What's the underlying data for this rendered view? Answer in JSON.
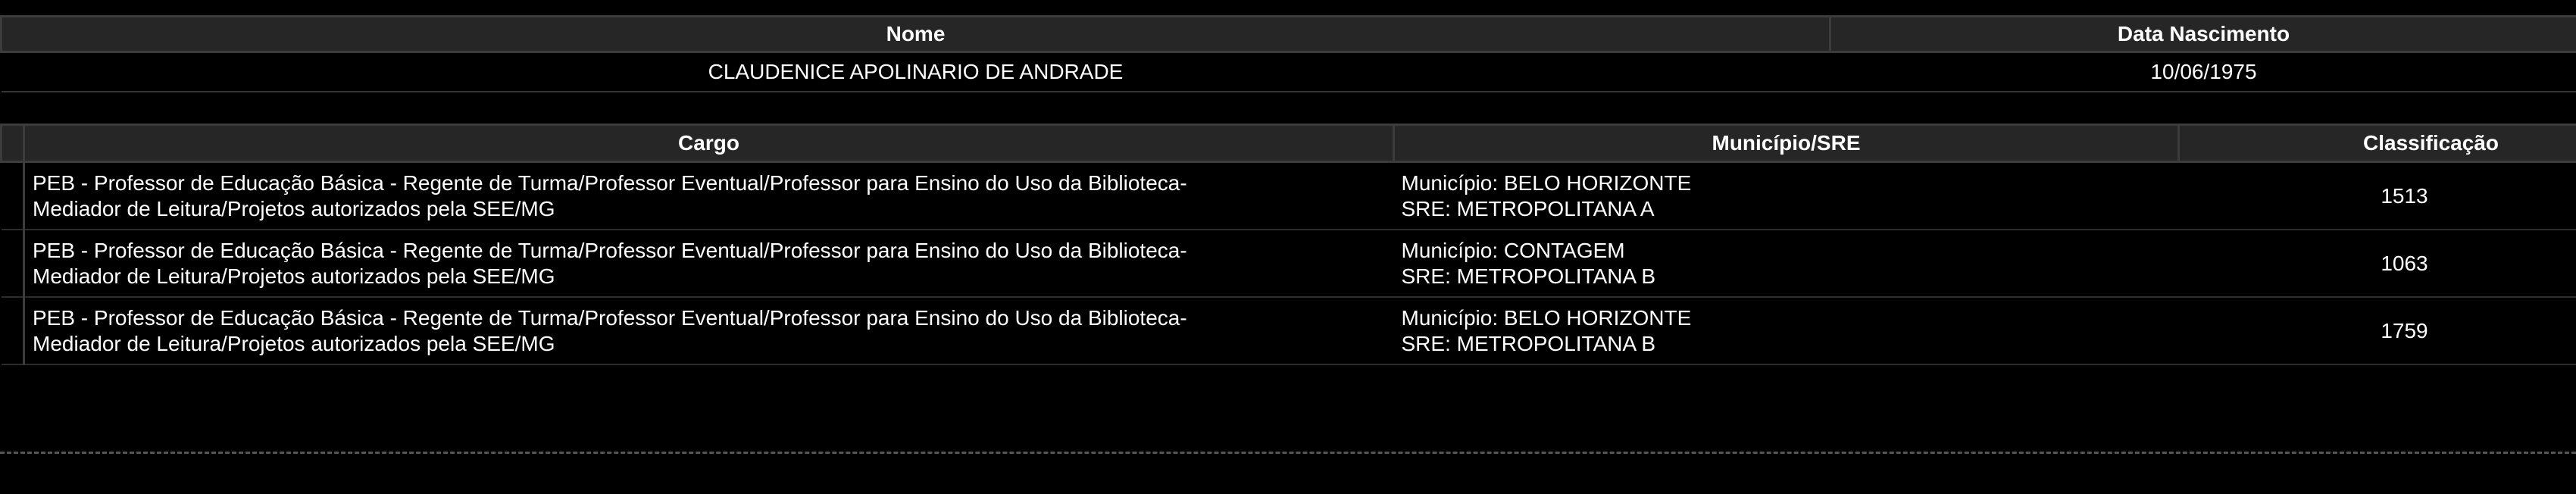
{
  "person": {
    "headers": {
      "nome": "Nome",
      "data_nascimento": "Data Nascimento"
    },
    "row": {
      "nome": "CLAUDENICE APOLINARIO DE ANDRADE",
      "data_nascimento": "10/06/1975"
    }
  },
  "cargos": {
    "headers": {
      "cargo": "Cargo",
      "municipio_sre": "Município/SRE",
      "classificacao": "Classificação"
    },
    "rows": [
      {
        "cargo_line1": "PEB - Professor de Educação Básica - Regente de Turma/Professor Eventual/Professor para Ensino do Uso da Biblioteca-",
        "cargo_line2": "Mediador de Leitura/Projetos autorizados pela SEE/MG",
        "municipio": "Município: BELO HORIZONTE",
        "sre": "SRE: METROPOLITANA A",
        "classificacao": "1513"
      },
      {
        "cargo_line1": "PEB - Professor de Educação Básica - Regente de Turma/Professor Eventual/Professor para Ensino do Uso da Biblioteca-",
        "cargo_line2": "Mediador de Leitura/Projetos autorizados pela SEE/MG",
        "municipio": "Município: CONTAGEM",
        "sre": "SRE: METROPOLITANA B",
        "classificacao": "1063"
      },
      {
        "cargo_line1": "PEB - Professor de Educação Básica - Regente de Turma/Professor Eventual/Professor para Ensino do Uso da Biblioteca-",
        "cargo_line2": "Mediador de Leitura/Projetos autorizados pela SEE/MG",
        "municipio": "Município: BELO HORIZONTE",
        "sre": "SRE: METROPOLITANA B",
        "classificacao": "1759"
      }
    ]
  }
}
